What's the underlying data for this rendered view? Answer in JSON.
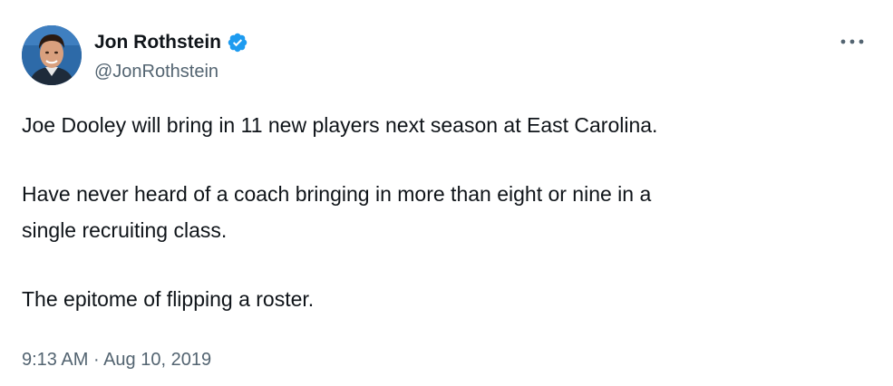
{
  "author": {
    "display_name": "Jon Rothstein",
    "handle": "@JonRothstein",
    "verified": true,
    "avatar_icon": "profile-photo",
    "verified_icon": "verified-badge-icon",
    "verified_color": "#1d9bf0"
  },
  "actions": {
    "more_icon": "more-options-icon"
  },
  "tweet": {
    "paragraphs": [
      "Joe Dooley will bring in 11 new players next season at East Carolina.",
      "Have never heard of a coach bringing in more than eight or nine in a",
      "single recruiting class.",
      "The epitome of flipping a roster."
    ],
    "time": "9:13 AM",
    "separator": "·",
    "date": "Aug 10, 2019"
  },
  "colors": {
    "text_primary": "#0f1419",
    "text_secondary": "#536471",
    "background": "#ffffff"
  }
}
